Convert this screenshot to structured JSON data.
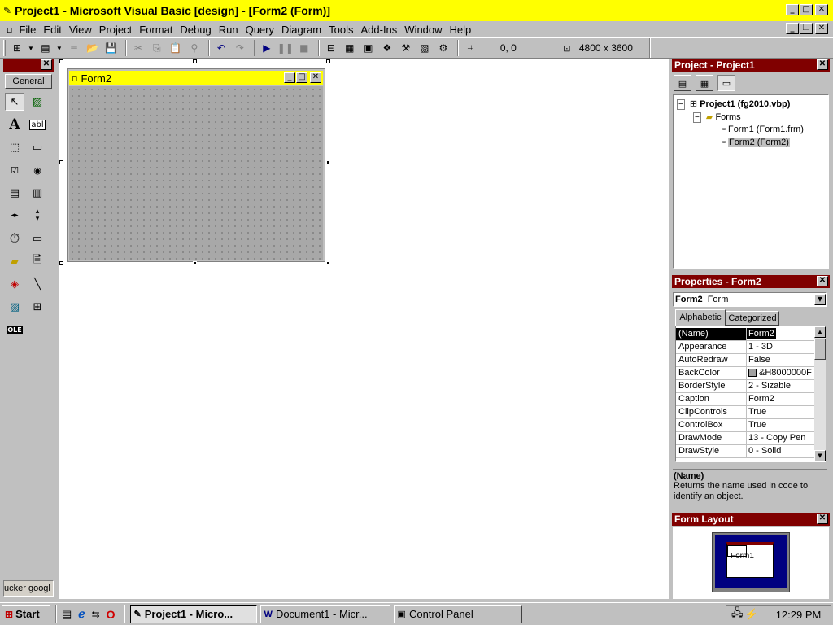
{
  "window": {
    "title": "Project1 - Microsoft Visual Basic [design] - [Form2 (Form)]"
  },
  "menu": [
    "File",
    "Edit",
    "View",
    "Project",
    "Format",
    "Debug",
    "Run",
    "Query",
    "Diagram",
    "Tools",
    "Add-Ins",
    "Window",
    "Help"
  ],
  "toolbar": {
    "position": "0, 0",
    "size": "4800 x 3600"
  },
  "toolbox": {
    "tab": "General",
    "bottom_item": "ucker googl"
  },
  "form": {
    "caption": "Form2"
  },
  "project": {
    "title": "Project - Project1",
    "root": "Project1 (fg2010.vbp)",
    "folder": "Forms",
    "items": [
      "Form1 (Form1.frm)",
      "Form2 (Form2)"
    ]
  },
  "properties": {
    "title": "Properties - Form2",
    "object_name": "Form2",
    "object_type": "Form",
    "tabs": [
      "Alphabetic",
      "Categorized"
    ],
    "rows": [
      {
        "k": "(Name)",
        "v": "Form2"
      },
      {
        "k": "Appearance",
        "v": "1 - 3D"
      },
      {
        "k": "AutoRedraw",
        "v": "False"
      },
      {
        "k": "BackColor",
        "v": "&H8000000F"
      },
      {
        "k": "BorderStyle",
        "v": "2 - Sizable"
      },
      {
        "k": "Caption",
        "v": "Form2"
      },
      {
        "k": "ClipControls",
        "v": "True"
      },
      {
        "k": "ControlBox",
        "v": "True"
      },
      {
        "k": "DrawMode",
        "v": "13 - Copy Pen"
      },
      {
        "k": "DrawStyle",
        "v": "0 - Solid"
      }
    ],
    "desc_title": "(Name)",
    "desc_text": "Returns the name used in code to identify an object."
  },
  "layout": {
    "title": "Form Layout",
    "form_label": "Form1"
  },
  "taskbar": {
    "start": "Start",
    "tasks": [
      "Project1 - Micro...",
      "Document1 - Micr...",
      "Control Panel"
    ],
    "clock": "12:29 PM"
  },
  "colors": {
    "title_bar": "#ffff00",
    "panel_head": "#800000",
    "desktop_gray": "#c0c0c0"
  }
}
